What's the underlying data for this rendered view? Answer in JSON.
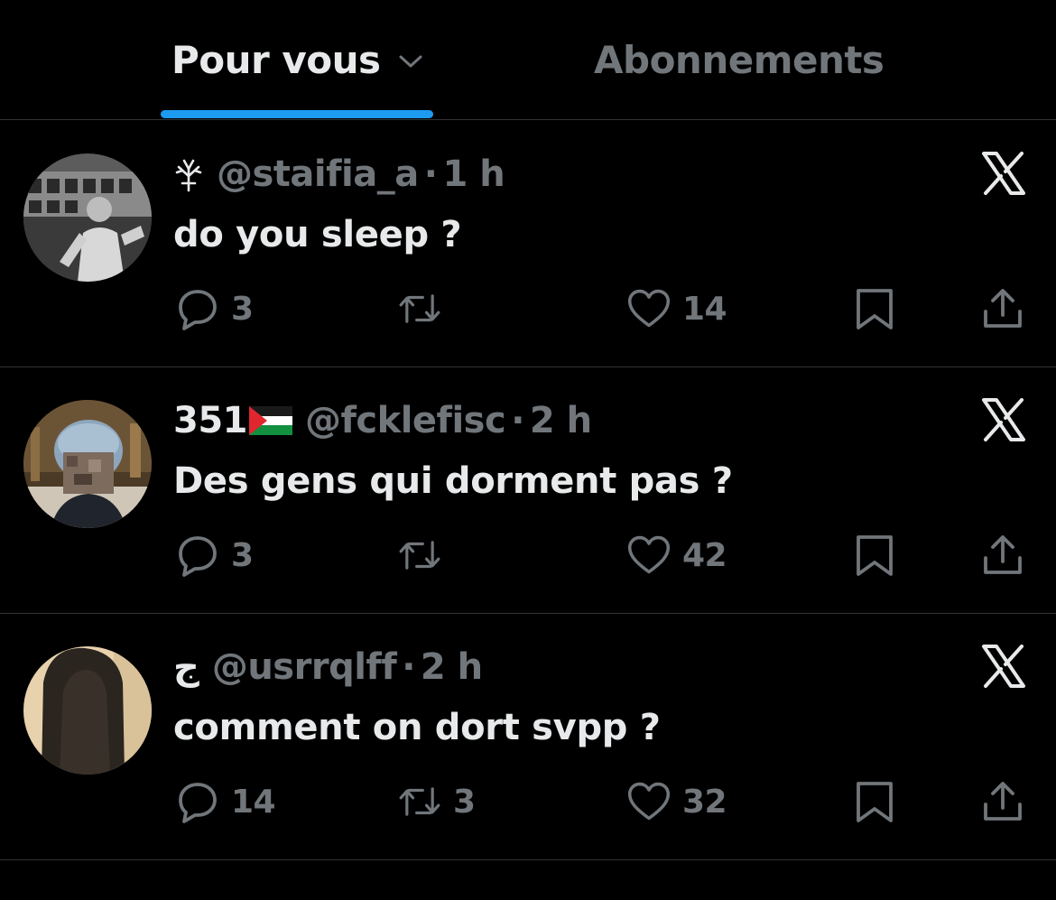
{
  "tabs": {
    "for_you": "Pour vous",
    "following": "Abonnements"
  },
  "colors": {
    "background": "#000000",
    "primary_text": "#e7e9ea",
    "secondary_text": "#71767b",
    "accent": "#1d9bf0",
    "divider": "#2f3336"
  },
  "posts": [
    {
      "name_icon": "sprout-glyph-icon",
      "display_name": "",
      "handle": "@staifia_a",
      "separator": "·",
      "time": "1 h",
      "text": "do you sleep ?",
      "replies": "3",
      "reposts": "",
      "likes": "14"
    },
    {
      "name_icon": "palestine-flag-icon",
      "display_name": "351",
      "handle": "@fcklefisc",
      "separator": "·",
      "time": "2 h",
      "text": "Des gens qui dorment pas ?",
      "replies": "3",
      "reposts": "",
      "likes": "42"
    },
    {
      "name_icon": "arabic-letter-icon",
      "display_name": "ج",
      "handle": "@usrrqlff",
      "separator": "·",
      "time": "2 h",
      "text": "comment on dort svpp ?",
      "replies": "14",
      "reposts": "3",
      "likes": "32"
    }
  ]
}
